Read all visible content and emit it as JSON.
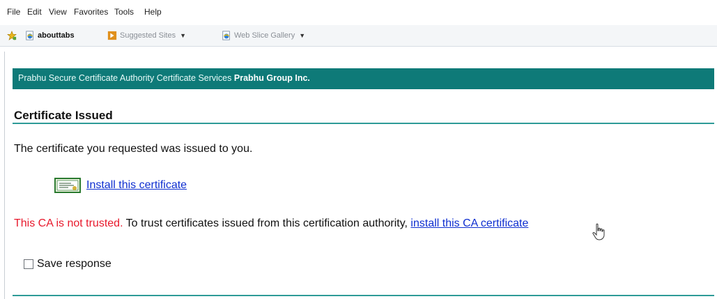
{
  "menu": [
    "File",
    "Edit",
    "View",
    "Favorites",
    "Tools",
    "Help"
  ],
  "favorites_bar": {
    "item1": "abouttabs",
    "item2": "Suggested Sites",
    "item3": "Web Slice Gallery"
  },
  "banner": {
    "prefix": "Prabhu Secure Certificate Authority Certificate Services",
    "company": "Prabhu Group Inc."
  },
  "section_title": "Certificate Issued",
  "issued_message": "The certificate you requested was issued to you.",
  "install_cert_link": "Install this certificate",
  "untrusted": {
    "warning": "This CA is not trusted.",
    "message": "To trust certificates issued from this certification authority,",
    "link": "install this CA certificate"
  },
  "save_response_label": "Save response",
  "colors": {
    "banner_bg": "#0e7a78",
    "rule": "#2e9b97",
    "link": "#0f2fd0",
    "warning": "#e8192c"
  },
  "icons": {
    "favorites_star": "favorites-star-icon",
    "ie_page": "ie-page-icon",
    "suggested_sites": "suggested-sites-icon",
    "certificate": "certificate-icon",
    "cursor": "hand-cursor-icon"
  }
}
